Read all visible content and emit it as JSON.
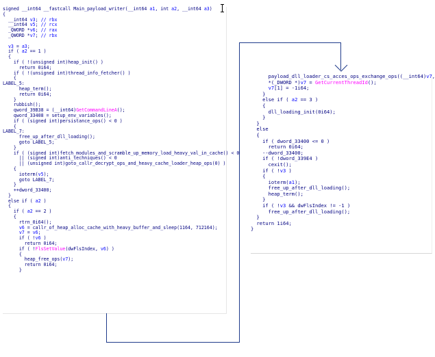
{
  "left_block": {
    "lines": [
      "signed __int64 __fastcall Main_payload_writer(__int64 a1, int a2, __int64 a3)",
      "{",
      "  __int64 v3; // rbx",
      "  __int64 v5; // rcx",
      "  _QWORD *v6; // rax",
      "  _QWORD *v7; // rbx",
      "",
      "  v3 = a3;",
      "  if ( a2 == 1 )",
      "  {",
      "    if ( !(unsigned int)heap_init() )",
      "      return 0i64;",
      "    if ( !(unsigned int)thread_info_fetcher() )",
      "    {",
      "LABEL_5:",
      "      heap_term();",
      "      return 0i64;",
      "    }",
      "    rubbish();",
      "    qword_39B38 = (__int64)GetCommandLineA();",
      "    qword_33408 = setup_env_variables();",
      "    if ( (signed int)persistance_ops() < 0 )",
      "    {",
      "LABEL_7:",
      "      free_up_after_dll_loading();",
      "      goto LABEL_5;",
      "    }",
      "    if ( (signed int)fetch_modules_and_scramble_up_memory_load_heavy_val_in_cache() < 0",
      "      || (signed int)anti_techniques() < 0",
      "      || (unsigned int)goto_callr_decrypt_ops_and_heavy_cache_loader_heap_ops(0) )",
      "    {",
      "      ioterm(v5);",
      "      goto LABEL_7;",
      "    }",
      "    ++dword_33400;",
      "  }",
      "  else if ( a2 )",
      "  {",
      "    if ( a2 == 2 )",
      "    {",
      "      rtrn_0i64();",
      "      v6 = callr_of_heap_alloc_cache_with_heavy_buffer_and_sleep(1164, 712164);",
      "      v7 = v6;",
      "      if ( !v6 )",
      "        return 0i64;",
      "      if ( !FlsSetValue(dwFlsIndex, v6) )",
      "      {",
      "        heap_free_ops(v7);",
      "        return 0i64;",
      "      }"
    ]
  },
  "right_block": {
    "lines": [
      "      payload_dll_loader_cs_acces_ops_exchange_ops((__int64)v7, 0i64);",
      "      *(_DWORD *)v7 = GetCurrentThreadId();",
      "      v7[1] = -1i64;",
      "    }",
      "    else if ( a2 == 3 )",
      "    {",
      "      dll_loading_init(0i64);",
      "    }",
      "  }",
      "  else",
      "  {",
      "    if ( dword_33400 <= 0 )",
      "      return 0i64;",
      "    --dword_33400;",
      "    if ( !dword_339E4 )",
      "      cexit();",
      "    if ( !v3 )",
      "    {",
      "      ioterm(a1);",
      "      free_up_after_dll_loading();",
      "      heap_term();",
      "    }",
      "    if ( !v3 && dwFlsIndex != -1 )",
      "      free_up_after_dll_loading();",
      "  }",
      "  return 1i64;",
      "}"
    ]
  },
  "colors": {
    "code": "#000080",
    "comment": "#0000ff",
    "api": "#ff00ff",
    "edge": "#1e3a8a"
  }
}
